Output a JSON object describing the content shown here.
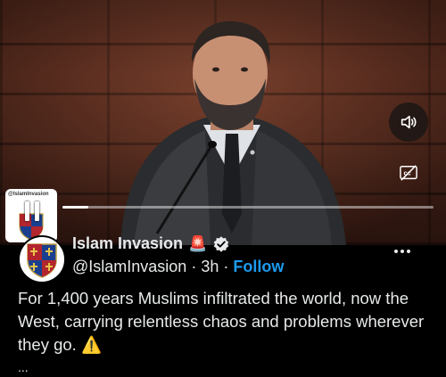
{
  "video": {
    "thumbnail_caption": "@IslamInvasion",
    "progress_fraction": 0.07,
    "mute_icon": "speaker-muted-icon",
    "captions_icon": "captions-off-icon",
    "pause_icon": "pause-icon"
  },
  "tweet": {
    "display_name": "Islam Invasion",
    "emoji_after_name": "🚨",
    "verified_icon": "verified-badge-icon",
    "handle": "@IslamInvasion",
    "separator": "·",
    "time": "3h",
    "follow_label": "Follow",
    "more_icon": "more-options-icon",
    "text": "For 1,400 years Muslims infiltrated the world, now the West, carrying relentless chaos and problems wherever they go. ⚠️",
    "truncation": "..."
  },
  "colors": {
    "background": "#000000",
    "text": "#e7e9ea",
    "link": "#1d9bf0"
  }
}
